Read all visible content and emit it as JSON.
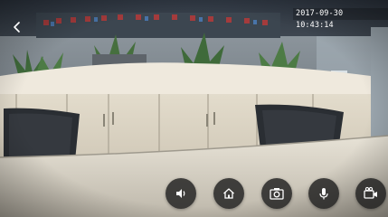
{
  "camera": {
    "timestamp": "2017-09-30  10:43:14",
    "scene_description_icon": "office-camera-feed"
  },
  "navigation": {
    "back_icon": "chevron-left-icon"
  },
  "controls": [
    {
      "name": "sound-toggle-button",
      "icon": "speaker-icon"
    },
    {
      "name": "home-button",
      "icon": "home-icon"
    },
    {
      "name": "snapshot-button",
      "icon": "camera-icon"
    },
    {
      "name": "talk-button",
      "icon": "microphone-icon"
    },
    {
      "name": "record-button",
      "icon": "video-camera-icon"
    }
  ],
  "colors": {
    "control_background": "#1e1e1e",
    "control_icon": "#ffffff",
    "timestamp_text": "#ffffff"
  }
}
